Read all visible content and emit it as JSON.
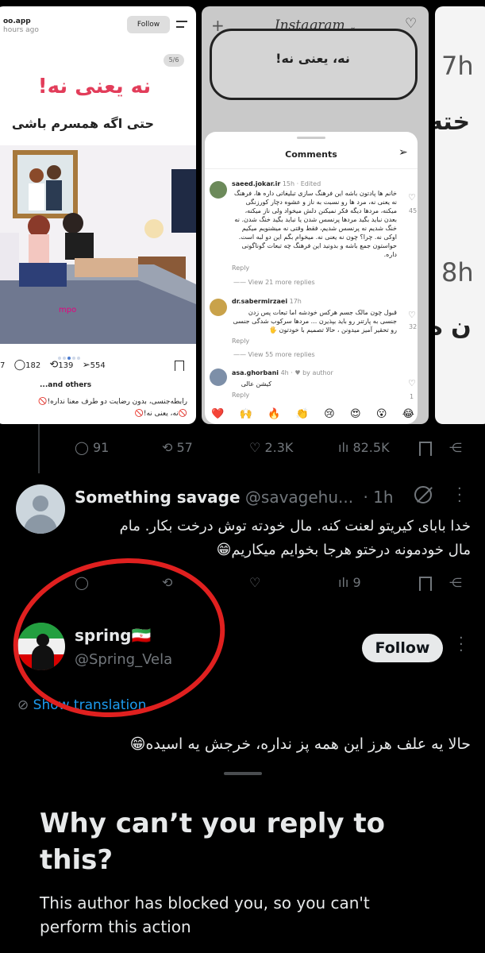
{
  "card1": {
    "site": "oo.app",
    "time": "hours ago",
    "follow": "Follow",
    "counter": "5/6",
    "headline": "نه یعنی نه!",
    "subhead": "حتی اگه همسرم باشی",
    "watermark": "mpo",
    "stats": {
      "a": "7",
      "comments": "182",
      "reposts": "139",
      "shares": "554"
    },
    "liked_by": "...and others",
    "caption1": "رابطه‌جنسی، بدون رضایت دو طرف معنا نداره!🚫",
    "caption2": "🚫نه، یعنی نه!🚫"
  },
  "card2": {
    "brand": "Instagram",
    "banner": "نه، یعنی نه!",
    "comments_title": "Comments",
    "comments": [
      {
        "user": "saeed.jokar.ir",
        "meta": "15h · Edited",
        "text": "خانم ها پادتون باشه این فرهنگ سازی تبلیغاتی داره ها، فرهنگ نه یعنی نه، مرد ها رو نسبت به ناز و عشوه دچار کورزنگی میکنه، مردها دیگه فکر نمیکنن دلش میخواد ولی ناز میکنه، بعدن نباید بگید مردها پرنسس شدن یا نباید بگید خنگ شدن. نه خنگ شدیم نه پرنسس شدیم، فقط وقتی نه میشنویم میکیم اوکی نه. چرا؟ چون نه یعنی نه. میخوام بگم این دو لبه است. حواستون جمع باشه و بدونید این فرهنگ چه تبعات گوناگونی داره.",
        "reply": "Reply",
        "view": "View 21 more replies",
        "likes": "45"
      },
      {
        "user": "dr.sabermirzaei",
        "meta": "17h",
        "text": "قبول چون مالک جسم هرکس خودشه اما تبعات پس زدن جنسی به پارتنر رو باید بپذیرن ... مردها سرکوب شدگی جنسی رو تحقیر آمیز میدونن ، حالا تصمیم با خودتون 🖐",
        "reply": "Reply",
        "view": "View 55 more replies",
        "likes": "32"
      },
      {
        "user": "asa.ghorbani",
        "meta": "4h · ♥ by author",
        "text": "کیشن عالی",
        "reply": "Reply",
        "likes": "1"
      }
    ],
    "emojis": [
      "❤️",
      "🙌",
      "🔥",
      "👏",
      "😢",
      "😍",
      "😮",
      "😂"
    ]
  },
  "card3": {
    "t1": "7h",
    "t2": "خته",
    "t3": "8h",
    "t4": "ن ه"
  },
  "tweet_actions": {
    "replies": "91",
    "reposts": "57",
    "likes": "2.3K",
    "views": "82.5K"
  },
  "reply1": {
    "name": "Something savage",
    "handle": "@savagehu...",
    "time": "· 1h",
    "text_line1": "خدا بابای کیریتو لعنت کنه. مال خودته توش درخت بکار. مام",
    "text_line2": "مال خودمونه درختو هرجا بخوایم میکاریم😁",
    "views": "9"
  },
  "reply2": {
    "name": "spring🇮🇷",
    "handle": "@Spring_Vela",
    "follow": "Follow",
    "translate": "Show translation",
    "text": "حالا یه علف هرز این همه پز نداره، خرجش یه اسیده😁"
  },
  "sheet": {
    "title": "Why can’t you reply to this?",
    "body": "This author has blocked you, so you can't perform this action"
  },
  "colors": {
    "annotation": "#e0201f",
    "follow_bg": "#e7e9ea",
    "muted": "#71767b"
  }
}
